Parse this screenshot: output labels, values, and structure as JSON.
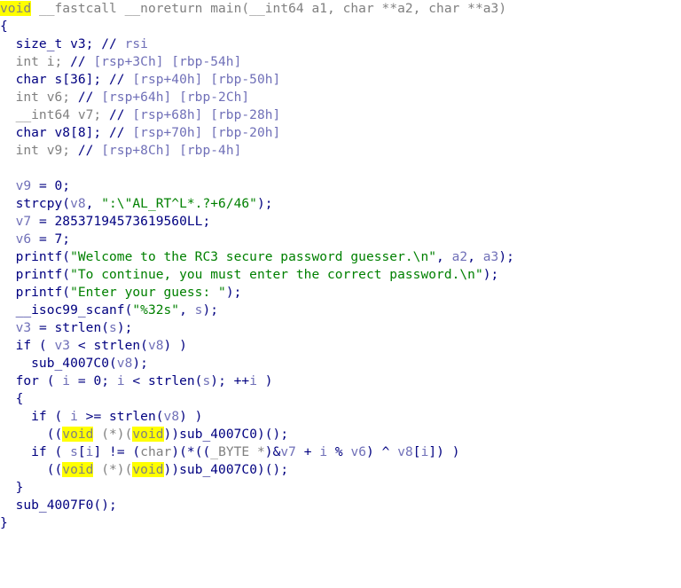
{
  "view": "pseudocode",
  "colors": {
    "code": "#000080",
    "type": "#808080",
    "variable": "#7070b8",
    "string": "#008000",
    "highlight": "#ffff00"
  },
  "lines": [
    [
      {
        "k": "h",
        "t": "void"
      },
      {
        "k": "g",
        "t": " __fastcall __noreturn main(__int64 a1, char **a2, char **a3)"
      }
    ],
    [
      {
        "k": "n",
        "t": "{"
      }
    ],
    [
      {
        "k": "n",
        "t": "  size_t v3; // "
      },
      {
        "k": "v",
        "t": "rsi"
      }
    ],
    [
      {
        "k": "g",
        "t": "  int i; "
      },
      {
        "k": "n",
        "t": "// "
      },
      {
        "k": "v",
        "t": "[rsp+3Ch] [rbp-54h]"
      }
    ],
    [
      {
        "k": "n",
        "t": "  char s[36]; // "
      },
      {
        "k": "v",
        "t": "[rsp+40h] [rbp-50h]"
      }
    ],
    [
      {
        "k": "g",
        "t": "  int v6; "
      },
      {
        "k": "n",
        "t": "// "
      },
      {
        "k": "v",
        "t": "[rsp+64h] [rbp-2Ch]"
      }
    ],
    [
      {
        "k": "g",
        "t": "  __int64 v7; "
      },
      {
        "k": "n",
        "t": "// "
      },
      {
        "k": "v",
        "t": "[rsp+68h] [rbp-28h]"
      }
    ],
    [
      {
        "k": "n",
        "t": "  char v8[8]; // "
      },
      {
        "k": "v",
        "t": "[rsp+70h] [rbp-20h]"
      }
    ],
    [
      {
        "k": "g",
        "t": "  int v9; "
      },
      {
        "k": "n",
        "t": "// "
      },
      {
        "k": "v",
        "t": "[rsp+8Ch] [rbp-4h]"
      }
    ],
    [],
    [
      {
        "k": "v",
        "t": "  v9"
      },
      {
        "k": "n",
        "t": " = 0;"
      }
    ],
    [
      {
        "k": "n",
        "t": "  strcpy("
      },
      {
        "k": "v",
        "t": "v8"
      },
      {
        "k": "n",
        "t": ", "
      },
      {
        "k": "s",
        "t": "\":\\\"AL_RT^L*.?+6/46\""
      },
      {
        "k": "n",
        "t": ");"
      }
    ],
    [
      {
        "k": "v",
        "t": "  v7"
      },
      {
        "k": "n",
        "t": " = 28537194573619560LL;"
      }
    ],
    [
      {
        "k": "v",
        "t": "  v6"
      },
      {
        "k": "n",
        "t": " = 7;"
      }
    ],
    [
      {
        "k": "n",
        "t": "  printf("
      },
      {
        "k": "s",
        "t": "\"Welcome to the RC3 secure password guesser.\\n\""
      },
      {
        "k": "n",
        "t": ", "
      },
      {
        "k": "v",
        "t": "a2"
      },
      {
        "k": "n",
        "t": ", "
      },
      {
        "k": "v",
        "t": "a3"
      },
      {
        "k": "n",
        "t": ");"
      }
    ],
    [
      {
        "k": "n",
        "t": "  printf("
      },
      {
        "k": "s",
        "t": "\"To continue, you must enter the correct password.\\n\""
      },
      {
        "k": "n",
        "t": ");"
      }
    ],
    [
      {
        "k": "n",
        "t": "  printf("
      },
      {
        "k": "s",
        "t": "\"Enter your guess: \""
      },
      {
        "k": "n",
        "t": ");"
      }
    ],
    [
      {
        "k": "n",
        "t": "  __isoc99_scanf("
      },
      {
        "k": "s",
        "t": "\"%32s\""
      },
      {
        "k": "n",
        "t": ", "
      },
      {
        "k": "v",
        "t": "s"
      },
      {
        "k": "n",
        "t": ");"
      }
    ],
    [
      {
        "k": "v",
        "t": "  v3"
      },
      {
        "k": "n",
        "t": " = strlen("
      },
      {
        "k": "v",
        "t": "s"
      },
      {
        "k": "n",
        "t": ");"
      }
    ],
    [
      {
        "k": "n",
        "t": "  if ( "
      },
      {
        "k": "v",
        "t": "v3"
      },
      {
        "k": "n",
        "t": " < strlen("
      },
      {
        "k": "v",
        "t": "v8"
      },
      {
        "k": "n",
        "t": ") )"
      }
    ],
    [
      {
        "k": "n",
        "t": "    sub_4007C0("
      },
      {
        "k": "v",
        "t": "v8"
      },
      {
        "k": "n",
        "t": ");"
      }
    ],
    [
      {
        "k": "n",
        "t": "  for ( "
      },
      {
        "k": "v",
        "t": "i"
      },
      {
        "k": "n",
        "t": " = 0; "
      },
      {
        "k": "v",
        "t": "i"
      },
      {
        "k": "n",
        "t": " < strlen("
      },
      {
        "k": "v",
        "t": "s"
      },
      {
        "k": "n",
        "t": "); ++"
      },
      {
        "k": "v",
        "t": "i"
      },
      {
        "k": "n",
        "t": " )"
      }
    ],
    [
      {
        "k": "n",
        "t": "  {"
      }
    ],
    [
      {
        "k": "n",
        "t": "    if ( "
      },
      {
        "k": "v",
        "t": "i"
      },
      {
        "k": "n",
        "t": " >= strlen("
      },
      {
        "k": "v",
        "t": "v8"
      },
      {
        "k": "n",
        "t": ") )"
      }
    ],
    [
      {
        "k": "n",
        "t": "      (("
      },
      {
        "k": "h",
        "t": "void"
      },
      {
        "k": "g",
        "t": " (*)("
      },
      {
        "k": "h",
        "t": "void"
      },
      {
        "k": "n",
        "t": "))sub_4007C0)();"
      }
    ],
    [
      {
        "k": "n",
        "t": "    if ( "
      },
      {
        "k": "v",
        "t": "s"
      },
      {
        "k": "n",
        "t": "["
      },
      {
        "k": "v",
        "t": "i"
      },
      {
        "k": "n",
        "t": "] != ("
      },
      {
        "k": "g",
        "t": "char"
      },
      {
        "k": "n",
        "t": ")(*(("
      },
      {
        "k": "g",
        "t": "_BYTE *"
      },
      {
        "k": "n",
        "t": ")&"
      },
      {
        "k": "v",
        "t": "v7"
      },
      {
        "k": "n",
        "t": " + "
      },
      {
        "k": "v",
        "t": "i"
      },
      {
        "k": "n",
        "t": " % "
      },
      {
        "k": "v",
        "t": "v6"
      },
      {
        "k": "n",
        "t": ") ^ "
      },
      {
        "k": "v",
        "t": "v8"
      },
      {
        "k": "n",
        "t": "["
      },
      {
        "k": "v",
        "t": "i"
      },
      {
        "k": "n",
        "t": "]) )"
      }
    ],
    [
      {
        "k": "n",
        "t": "      (("
      },
      {
        "k": "h",
        "t": "void"
      },
      {
        "k": "g",
        "t": " (*)("
      },
      {
        "k": "h",
        "t": "void"
      },
      {
        "k": "n",
        "t": "))sub_4007C0)();"
      }
    ],
    [
      {
        "k": "n",
        "t": "  }"
      }
    ],
    [
      {
        "k": "n",
        "t": "  sub_4007F0();"
      }
    ],
    [
      {
        "k": "n",
        "t": "}"
      }
    ]
  ]
}
